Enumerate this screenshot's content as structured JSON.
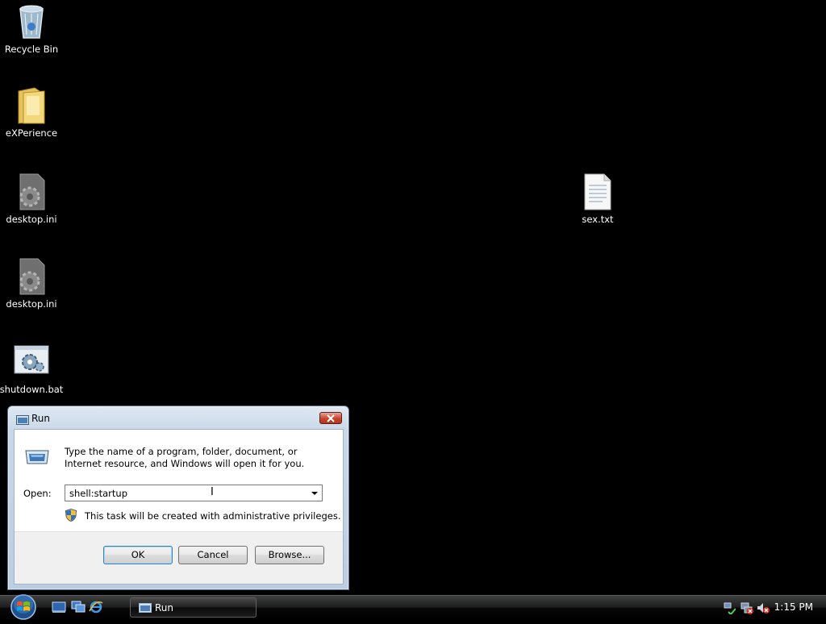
{
  "desktop": {
    "icons": [
      {
        "label": "Recycle Bin",
        "icon": "recycle-bin-icon"
      },
      {
        "label": "eXPerience",
        "icon": "folder-icon"
      },
      {
        "label": "desktop.ini",
        "icon": "settings-file-icon"
      },
      {
        "label": "desktop.ini",
        "icon": "settings-file-icon"
      },
      {
        "label": "shutdown.bat",
        "icon": "batch-file-icon"
      },
      {
        "label": "sex.txt",
        "icon": "text-file-icon"
      }
    ]
  },
  "run_dialog": {
    "title": "Run",
    "description": "Type the name of a program, folder, document, or Internet resource, and Windows will open it for you.",
    "open_label": "Open:",
    "open_value": "shell:startup",
    "admin_notice": "This task will be created with administrative privileges.",
    "buttons": {
      "ok": "OK",
      "cancel": "Cancel",
      "browse": "Browse..."
    }
  },
  "taskbar": {
    "task_button": "Run",
    "clock": "1:15 PM"
  },
  "colors": {
    "desktop_background": "#000000",
    "close_button": "#c8432b",
    "default_button_border": "#3c7fb1"
  }
}
